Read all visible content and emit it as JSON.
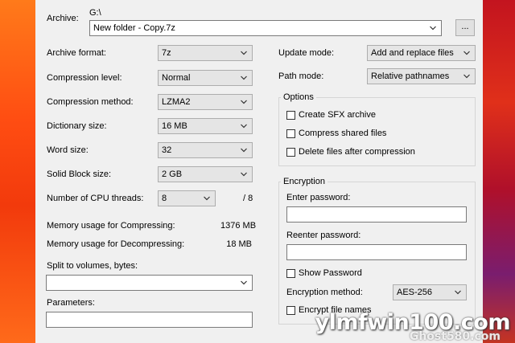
{
  "colors": {
    "dialog_bg": "#f0f0f0",
    "left_wallpaper": "#ff5a14",
    "right_wallpaper": "#c3141f"
  },
  "archive": {
    "label": "Archive:",
    "path": "G:\\",
    "filename": "New folder - Copy.7z",
    "browse_label": "..."
  },
  "left": {
    "archive_format": {
      "label": "Archive format:",
      "value": "7z"
    },
    "compression_level": {
      "label": "Compression level:",
      "value": "Normal"
    },
    "compression_method": {
      "label": "Compression method:",
      "value": "LZMA2"
    },
    "dictionary_size": {
      "label": "Dictionary size:",
      "value": "16 MB"
    },
    "word_size": {
      "label": "Word size:",
      "value": "32"
    },
    "solid_block_size": {
      "label": "Solid Block size:",
      "value": "2 GB"
    },
    "cpu_threads": {
      "label": "Number of CPU threads:",
      "value": "8",
      "total": "/ 8"
    },
    "memory_compress": {
      "label": "Memory usage for Compressing:",
      "value": "1376 MB"
    },
    "memory_decompress": {
      "label": "Memory usage for Decompressing:",
      "value": "18 MB"
    },
    "split": {
      "label": "Split to volumes, bytes:",
      "value": ""
    },
    "parameters": {
      "label": "Parameters:",
      "value": ""
    }
  },
  "right": {
    "update_mode": {
      "label": "Update mode:",
      "value": "Add and replace files"
    },
    "path_mode": {
      "label": "Path mode:",
      "value": "Relative pathnames"
    },
    "options": {
      "title": "Options",
      "create_sfx": "Create SFX archive",
      "compress_shared": "Compress shared files",
      "delete_after": "Delete files after compression"
    },
    "encryption": {
      "title": "Encryption",
      "enter_password": "Enter password:",
      "reenter_password": "Reenter password:",
      "show_password": "Show Password",
      "method_label": "Encryption method:",
      "method_value": "AES-256",
      "encrypt_names": "Encrypt file names"
    }
  },
  "watermark": {
    "main": "ylmfwin100.com",
    "sub": "Ghost580.com"
  }
}
